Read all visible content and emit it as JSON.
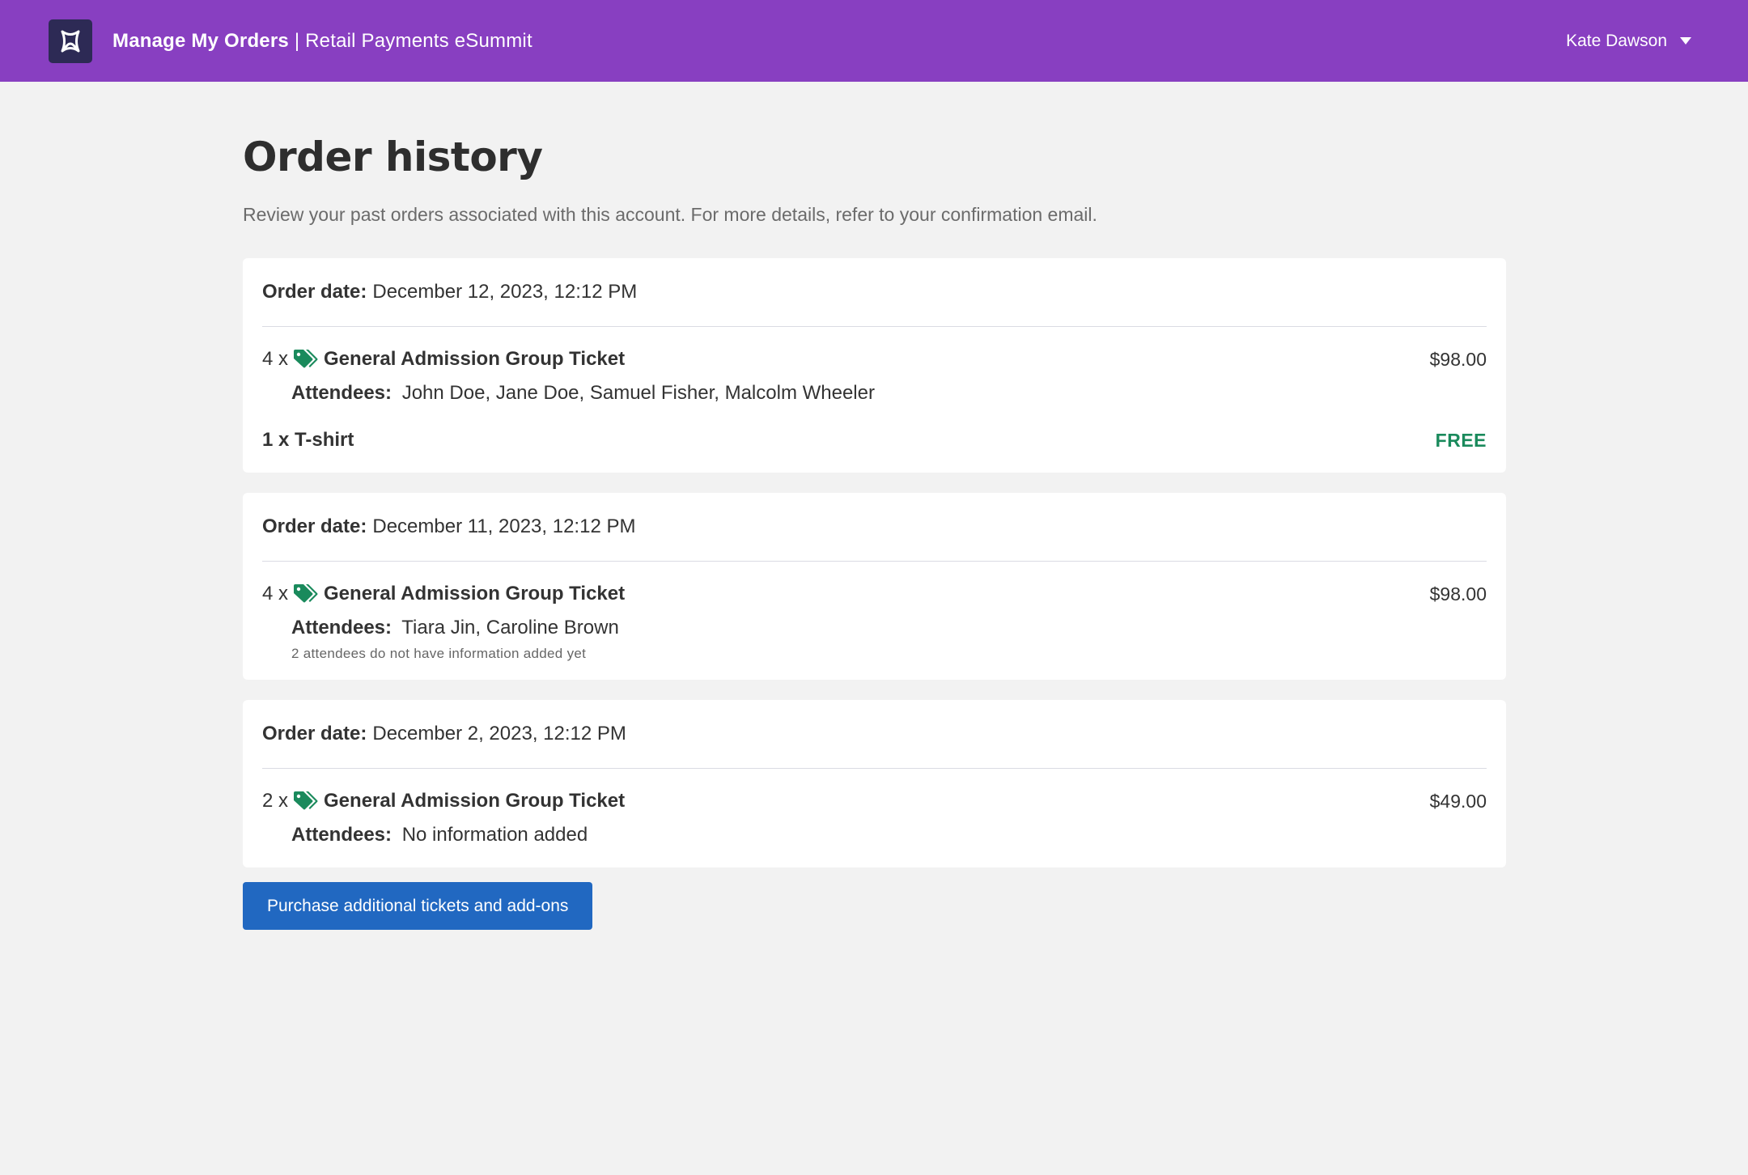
{
  "header": {
    "app_name": "Manage My Orders",
    "separator": "|",
    "event_name": "Retail Payments eSummit",
    "user_name": "Kate Dawson",
    "bg_color": "#883fc1"
  },
  "page": {
    "title": "Order history",
    "subtitle": "Review your past orders associated with this account. For more details, refer to your confirmation email."
  },
  "orders": [
    {
      "date_label": "Order date:",
      "date": "December 12, 2023, 12:12 PM",
      "ticket": {
        "qty": "4 x",
        "name": "General Admission Group Ticket",
        "price": "$98.00",
        "attendees_label": "Attendees:",
        "attendees": "John Doe, Jane Doe, Samuel Fisher, Malcolm Wheeler"
      },
      "addon": {
        "label": "1 x T-shirt",
        "price": "FREE"
      }
    },
    {
      "date_label": "Order date:",
      "date": "December 11, 2023, 12:12 PM",
      "ticket": {
        "qty": "4 x",
        "name": "General Admission Group Ticket",
        "price": "$98.00",
        "attendees_label": "Attendees:",
        "attendees": "Tiara Jin, Caroline Brown",
        "note": "2 attendees do not have information added yet"
      }
    },
    {
      "date_label": "Order date:",
      "date": "December 2, 2023, 12:12 PM",
      "ticket": {
        "qty": "2 x",
        "name": "General Admission Group Ticket",
        "price": "$49.00",
        "attendees_label": "Attendees:",
        "attendees": "No information added"
      }
    }
  ],
  "actions": {
    "purchase_label": "Purchase additional tickets and add-ons"
  },
  "colors": {
    "accent": "#883fc1",
    "button": "#2168c1",
    "tag_icon": "#1a8a5c",
    "free": "#1a8a5c"
  },
  "icons": {
    "logo": "event-logo-icon",
    "tag": "tag-icon",
    "caret": "chevron-down-icon"
  }
}
